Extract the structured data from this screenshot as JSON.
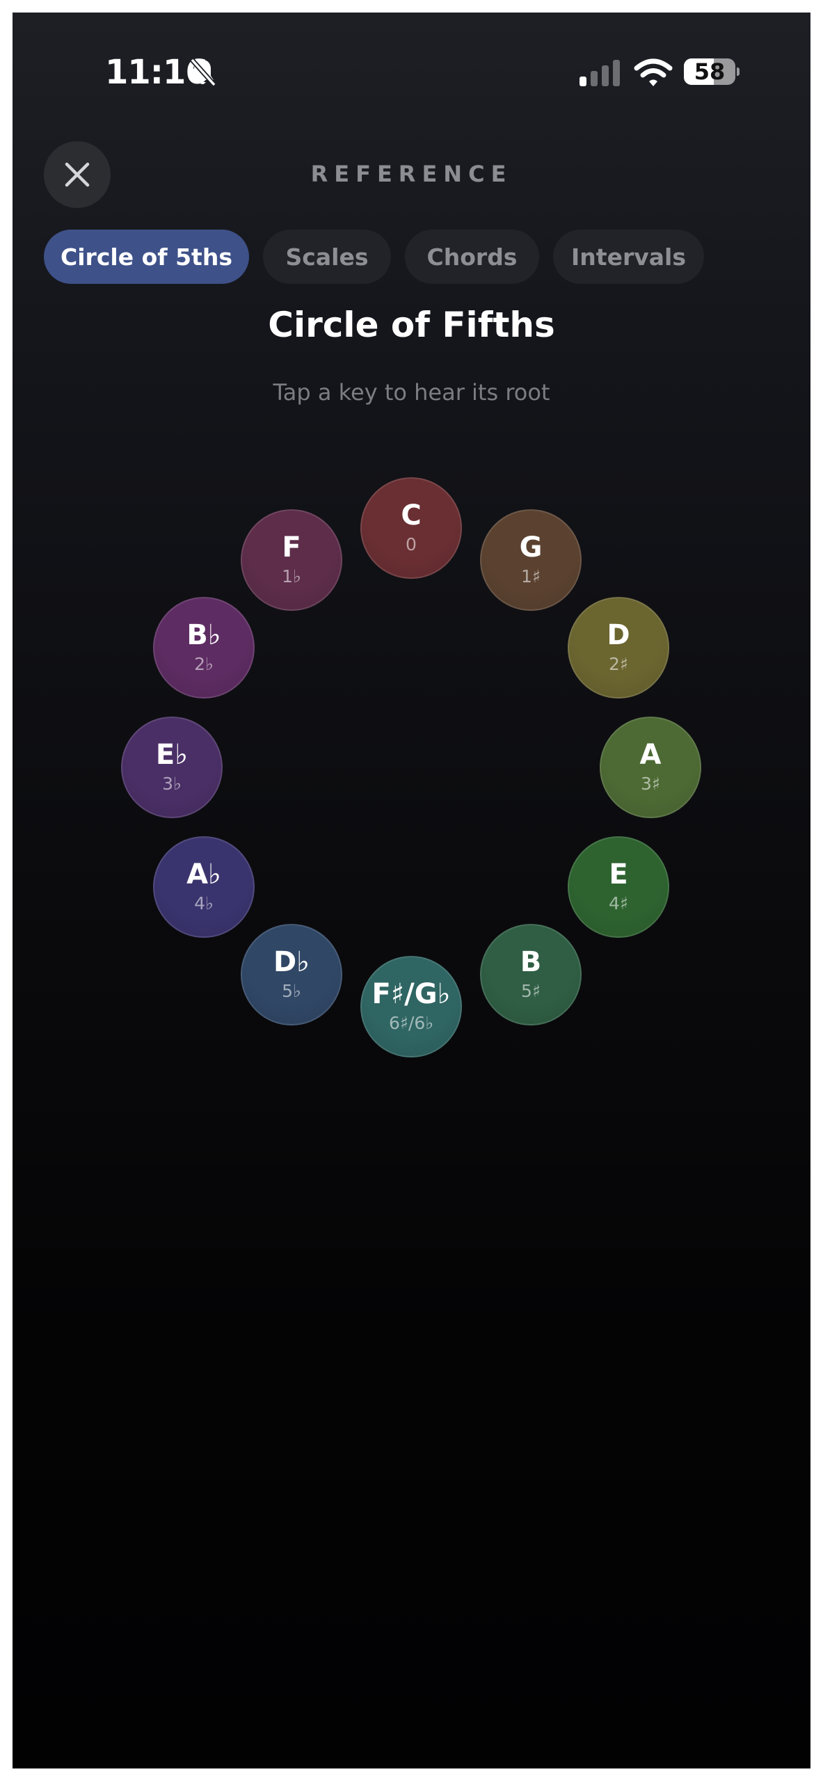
{
  "status_bar": {
    "time": "11:16",
    "battery_level": "58",
    "battery_fraction": 0.58
  },
  "header": {
    "title": "REFERENCE",
    "close_icon": "close-icon"
  },
  "tabs": [
    {
      "label": "Circle of 5ths",
      "active": true
    },
    {
      "label": "Scales",
      "active": false
    },
    {
      "label": "Chords",
      "active": false
    },
    {
      "label": "Intervals",
      "active": false
    }
  ],
  "main": {
    "title": "Circle of Fifths",
    "subtitle": "Tap a key to hear its root"
  },
  "keys": [
    {
      "name": "C",
      "signature": "0",
      "color": "#6a2f33"
    },
    {
      "name": "G",
      "signature": "1♯",
      "color": "#5b4230"
    },
    {
      "name": "D",
      "signature": "2♯",
      "color": "#6b6530"
    },
    {
      "name": "A",
      "signature": "3♯",
      "color": "#4d6a34"
    },
    {
      "name": "E",
      "signature": "4♯",
      "color": "#2e6330"
    },
    {
      "name": "B",
      "signature": "5♯",
      "color": "#2f5e44"
    },
    {
      "name": "F♯/G♭",
      "signature": "6♯/6♭",
      "color": "#2f6563"
    },
    {
      "name": "D♭",
      "signature": "5♭",
      "color": "#304766"
    },
    {
      "name": "A♭",
      "signature": "4♭",
      "color": "#3a346e"
    },
    {
      "name": "E♭",
      "signature": "3♭",
      "color": "#4a2f66"
    },
    {
      "name": "B♭",
      "signature": "2♭",
      "color": "#5d2c62"
    },
    {
      "name": "F",
      "signature": "1♭",
      "color": "#5d2d4a"
    }
  ]
}
